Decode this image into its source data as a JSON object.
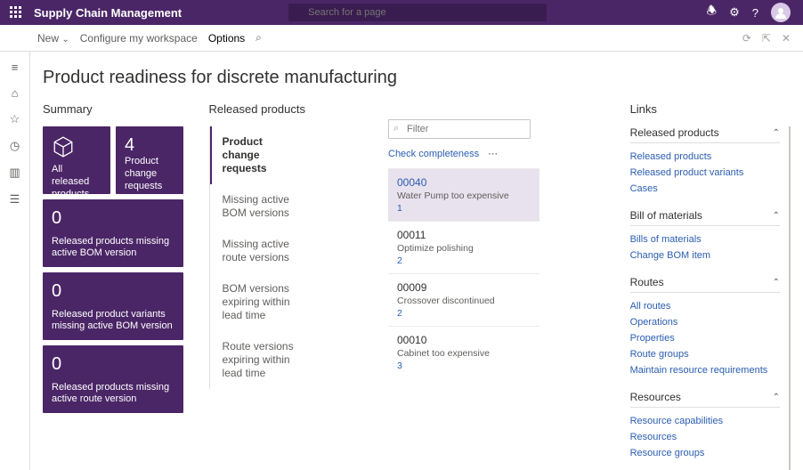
{
  "header": {
    "app_title": "Supply Chain Management",
    "search_placeholder": "Search for a page"
  },
  "toolbar": {
    "new": "New",
    "configure": "Configure my workspace",
    "options": "Options"
  },
  "page_title": "Product readiness for discrete manufacturing",
  "summary": {
    "heading": "Summary",
    "tiles": {
      "all_released_label": "All released products",
      "change_requests_value": "4",
      "change_requests_label": "Product change requests",
      "missing_bom_value": "0",
      "missing_bom_label": "Released products missing active BOM version",
      "variants_missing_bom_value": "0",
      "variants_missing_bom_label": "Released product variants missing active BOM version",
      "missing_route_value": "0",
      "missing_route_label": "Released products missing active route version"
    }
  },
  "released_products": {
    "heading": "Released products",
    "tabs": [
      "Product change requests",
      "Missing active BOM versions",
      "Missing active route versions",
      "BOM versions expiring within lead time",
      "Route versions expiring within lead time"
    ],
    "filter_placeholder": "Filter",
    "check_completeness": "Check completeness",
    "items": [
      {
        "id": "00040",
        "desc": "Water Pump too expensive",
        "count": "1"
      },
      {
        "id": "00011",
        "desc": "Optimize polishing",
        "count": "2"
      },
      {
        "id": "00009",
        "desc": "Crossover discontinued",
        "count": "2"
      },
      {
        "id": "00010",
        "desc": "Cabinet too expensive",
        "count": "3"
      }
    ]
  },
  "links": {
    "heading": "Links",
    "sections": [
      {
        "title": "Released products",
        "items": [
          "Released products",
          "Released product variants",
          "Cases"
        ]
      },
      {
        "title": "Bill of materials",
        "items": [
          "Bills of materials",
          "Change BOM item"
        ]
      },
      {
        "title": "Routes",
        "items": [
          "All routes",
          "Operations",
          "Properties",
          "Route groups",
          "Maintain resource requirements"
        ]
      },
      {
        "title": "Resources",
        "items": [
          "Resource capabilities",
          "Resources",
          "Resource groups"
        ]
      }
    ]
  }
}
